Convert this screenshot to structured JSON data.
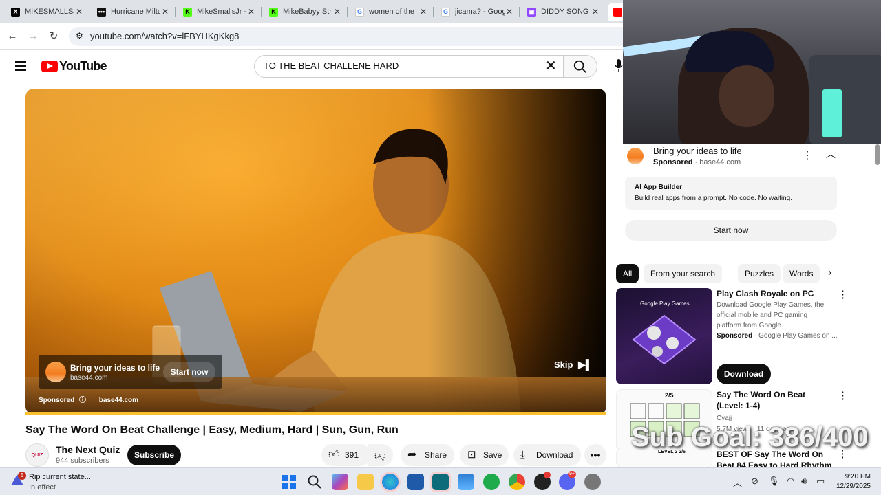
{
  "browser": {
    "tabs": [
      {
        "title": "MIKESMALLSJR",
        "fav_color": "#000000",
        "fav_char": "X"
      },
      {
        "title": "Hurricane Milton",
        "fav_color": "#111111",
        "fav_char": "•••"
      },
      {
        "title": "MikeSmallsJr - ",
        "fav_color": "#53fc18",
        "fav_char": "K"
      },
      {
        "title": "MikeBabyy Stre",
        "fav_color": "#53fc18",
        "fav_char": "K"
      },
      {
        "title": "women of the ",
        "fav_color": "#4285f4",
        "fav_char": "G"
      },
      {
        "title": "jicama? - Goog",
        "fav_color": "#4285f4",
        "fav_char": "G"
      },
      {
        "title": "DIDDY SONG",
        "fav_color": "#9146ff",
        "fav_char": "▣"
      }
    ],
    "url": "youtube.com/watch?v=lFBYHKgKkg8"
  },
  "youtube": {
    "logo_text": "YouTube",
    "search_value": "TO THE BEAT CHALLENE HARD"
  },
  "player": {
    "ad_title": "Bring your ideas to life",
    "ad_domain": "base44.com",
    "ad_cta": "Start now",
    "sponsored_label": "Sponsored",
    "sponsored_domain": "base44.com",
    "skip_label": "Skip"
  },
  "video": {
    "title": "Say The Word On Beat Challenge | Easy, Medium, Hard | Sun, Gun, Run",
    "channel": "The Next Quiz",
    "subscribers": "944 subscribers",
    "subscribe_label": "Subscribe",
    "likes": "391",
    "share_label": "Share",
    "save_label": "Save",
    "download_label": "Download"
  },
  "sidebar_ad": {
    "title": "Bring your ideas to life",
    "sponsored": "Sponsored",
    "domain": "base44.com",
    "box_heading": "AI App Builder",
    "box_desc": "Build real apps from a prompt. No code. No waiting.",
    "cta": "Start now"
  },
  "chips": [
    "All",
    "From your search",
    "Puzzles",
    "Words"
  ],
  "recommendations": [
    {
      "title": "Play Clash Royale on PC",
      "desc": "Download Google Play Games, the official mobile and PC gaming platform from Google.",
      "meta_bold": "Sponsored",
      "meta": "Google Play Games on ...",
      "cta": "Download",
      "thumb_label": "Google Play Games"
    },
    {
      "title": "Say The Word On Beat (Level: 1-4)",
      "channel": "Cyajj",
      "meta": "5.7M views · 11 days ago",
      "thumb_label": "2/5"
    },
    {
      "title": "BEST OF Say The Word On Beat 84 Easy to Hard Rhythm ...",
      "thumb_label": "LEVEL 2 2/6"
    }
  ],
  "overlay": {
    "sub_goal": "Sub Goal: 386/400"
  },
  "taskbar": {
    "notice_badge": "5",
    "notice_title": "Rip current state...",
    "notice_sub": "In effect",
    "discord_badge": "9+",
    "time": "9:20 PM",
    "date": "12/29/2025"
  }
}
